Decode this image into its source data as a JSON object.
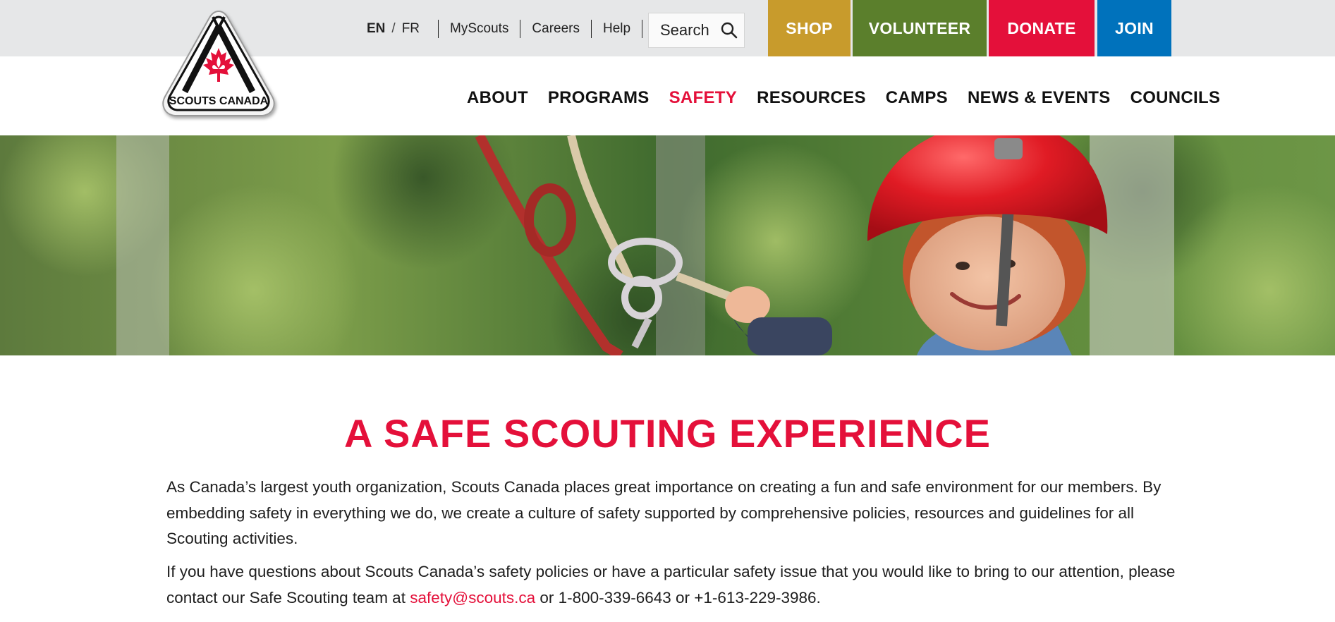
{
  "brand": {
    "name": "SCOUTS CANADA",
    "red": "#e4103a",
    "black": "#111111"
  },
  "utility": {
    "lang_en": "EN",
    "lang_sep": "/",
    "lang_fr": "FR",
    "links": [
      "MyScouts",
      "Careers",
      "Help"
    ],
    "search_label": "Search",
    "search_icon": "search-icon"
  },
  "cta": {
    "shop": {
      "label": "SHOP",
      "color": "#c89b2c"
    },
    "volunteer": {
      "label": "VOLUNTEER",
      "color": "#5b7f2c"
    },
    "donate": {
      "label": "DONATE",
      "color": "#e4103a"
    },
    "join": {
      "label": "JOIN",
      "color": "#0072bc"
    }
  },
  "nav": {
    "items": [
      "ABOUT",
      "PROGRAMS",
      "SAFETY",
      "RESOURCES",
      "CAMPS",
      "NEWS & EVENTS",
      "COUNCILS"
    ],
    "active": "SAFETY"
  },
  "hero": {
    "alt": "child in red helmet on climbing ropes"
  },
  "content": {
    "title": "A SAFE SCOUTING EXPERIENCE",
    "paragraph1": "As Canada’s largest youth organization, Scouts Canada places great importance on creating a fun and safe environment for our members. By embedding safety in everything we do, we create a culture of safety supported by comprehensive policies, resources and guidelines for all Scouting activities.",
    "paragraph2_before": "If you have questions about Scouts Canada’s safety policies or have a particular safety issue that you would like to bring to our attention, please contact our Safe Scouting team at ",
    "email": "safety@scouts.ca",
    "paragraph2_after": " or 1-800-339-6643 or +1-613-229-3986."
  }
}
